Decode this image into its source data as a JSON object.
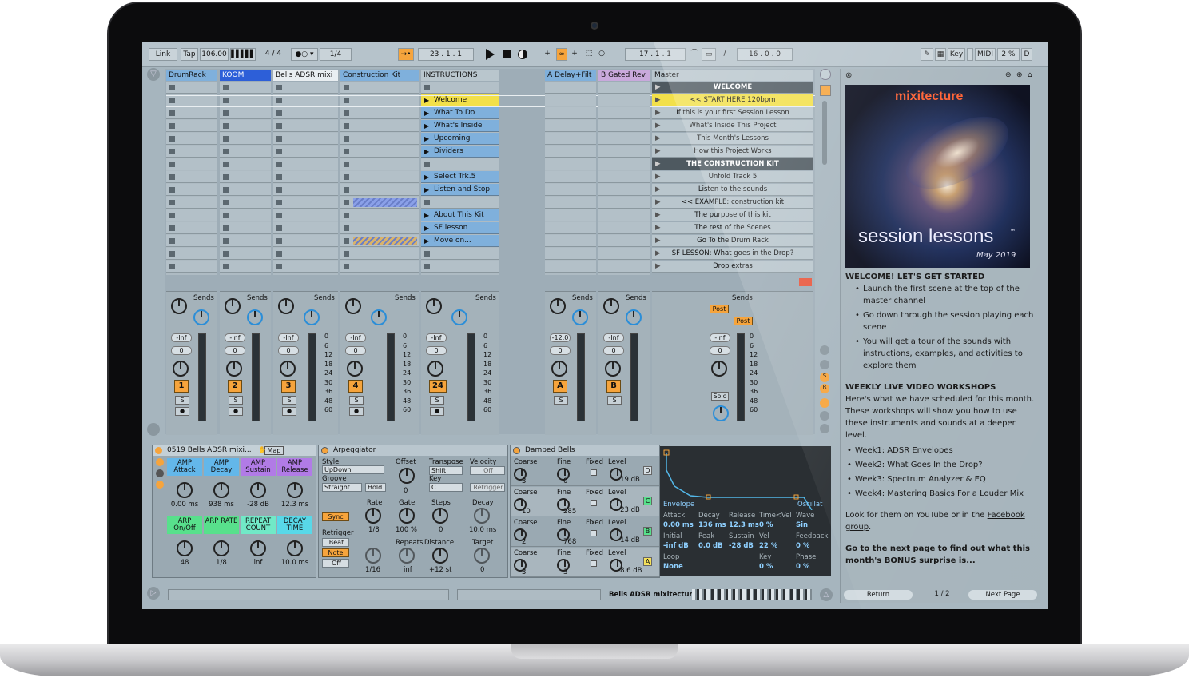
{
  "transport": {
    "link": "Link",
    "tap": "Tap",
    "tempo": "106.00",
    "signature": "4 / 4",
    "quantize": "1/4",
    "position": "23 .   1 .   1",
    "loop_start": "17 .   1 .   1",
    "loop_length": "16 .   0 .   0",
    "key": "Key",
    "midi": "MIDI",
    "cpu": "2 %",
    "d": "D"
  },
  "tracks": [
    {
      "name": "DrumRack",
      "color": "#7fb0dc",
      "number": "1"
    },
    {
      "name": "KOOM",
      "color": "#2d5fd8",
      "number": "2"
    },
    {
      "name": "Bells ADSR mixi",
      "color": "#e9eef1",
      "number": "3"
    },
    {
      "name": "Construction Kit",
      "color": "#7fb0dc",
      "number": "4"
    },
    {
      "name": "INSTRUCTIONS",
      "color": "#b9c6cd",
      "number": "24"
    }
  ],
  "returns": [
    {
      "name": "A Delay+Filt",
      "color": "#7fb0dc",
      "letter": "A"
    },
    {
      "name": "B Gated Rev",
      "color": "#c9a9dc",
      "letter": "B"
    }
  ],
  "master_name": "Master",
  "instruction_clips": [
    {
      "row": 1,
      "label": "Welcome"
    },
    {
      "row": 2,
      "label": "What To Do"
    },
    {
      "row": 3,
      "label": "What's Inside"
    },
    {
      "row": 4,
      "label": "Upcoming"
    },
    {
      "row": 5,
      "label": "Dividers"
    },
    {
      "row": 7,
      "label": "Select Trk.5"
    },
    {
      "row": 8,
      "label": "Listen and Stop"
    },
    {
      "row": 10,
      "label": "About This Kit"
    },
    {
      "row": 11,
      "label": "SF lesson"
    },
    {
      "row": 12,
      "label": "Move on..."
    }
  ],
  "scenes": [
    "WELCOME",
    "<< START HERE 120bpm",
    "If this is your first Session Lesson",
    "What's Inside This Project",
    "This Month's Lessons",
    "How this Project Works",
    "THE CONSTRUCTION KIT",
    "Unfold Track 5",
    "Listen to the sounds",
    "<< EXAMPLE: construction kit",
    "The purpose of this kit",
    "The rest of the Scenes",
    "Go To the Drum Rack",
    "SF LESSON: What goes in the Drop?",
    "Drop extras"
  ],
  "mixer": {
    "sends_label": "Sends",
    "inf": "-Inf",
    "zero": "0",
    "a_vol": "-12.0",
    "solo": "S",
    "master_solo": "Solo",
    "post": "Post",
    "ticks": [
      "0",
      "6",
      "12",
      "18",
      "24",
      "30",
      "36",
      "48",
      "60"
    ]
  },
  "rack": {
    "title": "0519 Bells ADSR mixi...",
    "map": "Map",
    "macros": [
      {
        "label": "AMP Attack",
        "value": "0.00 ms",
        "color": "#63b7ea"
      },
      {
        "label": "AMP Decay",
        "value": "938 ms",
        "color": "#63b7ea"
      },
      {
        "label": "AMP Sustain",
        "value": "-28 dB",
        "color": "#b17be6"
      },
      {
        "label": "AMP Release",
        "value": "12.3 ms",
        "color": "#b17be6"
      },
      {
        "label": "ARP On/Off",
        "value": "48",
        "color": "#58e08c"
      },
      {
        "label": "ARP RATE",
        "value": "1/8",
        "color": "#58e08c"
      },
      {
        "label": "REPEAT COUNT",
        "value": "inf",
        "color": "#71e9c7"
      },
      {
        "label": "DECAY TIME",
        "value": "10.0 ms",
        "color": "#58d8e8"
      }
    ]
  },
  "arpeggiator": {
    "title": "Arpeggiator",
    "style_label": "Style",
    "style": "UpDown",
    "groove_label": "Groove",
    "groove": "Straight",
    "hold": "Hold",
    "offset_label": "Offset",
    "offset": "0",
    "transpose_label": "Transpose",
    "transpose": "Shift",
    "key_label": "Key",
    "key": "C",
    "velocity_label": "Velocity",
    "velocity": "Off",
    "retrigger_btn": "Retrigger",
    "sync": "Sync",
    "rate_label": "Rate",
    "rate": "1/8",
    "gate_label": "Gate",
    "gate": "100 %",
    "steps_label": "Steps",
    "steps": "0",
    "decay_label": "Decay",
    "decay": "10.0 ms",
    "retrigger_label": "Retrigger",
    "beat": "Beat",
    "note": "Note",
    "off": "Off",
    "repeat_value": "1/16",
    "repeats_label": "Repeats",
    "repeats": "inf",
    "distance_label": "Distance",
    "distance": "+12 st",
    "target_label": "Target",
    "target": "0"
  },
  "bells": {
    "title": "Damped Bells",
    "rows": [
      {
        "coarse": "3",
        "fine": "0",
        "level": "-19 dB",
        "op": "D"
      },
      {
        "coarse": "10",
        "fine": "285",
        "level": "-23 dB",
        "op": "C"
      },
      {
        "coarse": "2",
        "fine": "768",
        "level": "-14 dB",
        "op": "B"
      },
      {
        "coarse": "3",
        "fine": "3",
        "level": "-8.6 dB",
        "op": "A"
      }
    ],
    "coarse_label": "Coarse",
    "fine_label": "Fine",
    "fixed_label": "Fixed",
    "level_label": "Level",
    "envelope": "Envelope",
    "oscillator": "Oscillat",
    "env_params": [
      {
        "label": "Attack",
        "value": "0.00 ms"
      },
      {
        "label": "Decay",
        "value": "136 ms"
      },
      {
        "label": "Release",
        "value": "12.3 ms"
      },
      {
        "label": "Time<Vel",
        "value": "0 %"
      },
      {
        "label": "Wave",
        "value": "Sin"
      },
      {
        "label": "Initial",
        "value": "-inf dB"
      },
      {
        "label": "Peak",
        "value": "0.0 dB"
      },
      {
        "label": "Sustain",
        "value": "-28 dB"
      },
      {
        "label": "Vel",
        "value": "22 %"
      },
      {
        "label": "Feedback",
        "value": "0 %"
      },
      {
        "label": "Loop",
        "value": "None"
      },
      {
        "label": "Key",
        "value": "0 %"
      },
      {
        "label": "Phase",
        "value": "0 %"
      }
    ]
  },
  "status": {
    "track_name": "Bells ADSR mixitecture"
  },
  "help": {
    "art_brand": "mixitecture",
    "art_title": "session lessons",
    "art_tm": "™",
    "art_date": "May 2019",
    "h1": "WELCOME! LET'S GET STARTED",
    "bullets1": [
      "Launch the first scene at the top of the master channel",
      "Go down through the session playing each scene",
      "You will get a tour of the sounds with instructions, examples, and activities to explore them"
    ],
    "h2": "WEEKLY LIVE VIDEO WORKSHOPS",
    "p2": "Here's what we have scheduled for this month. These workshops will show you how to use these instruments and sounds at a deeper level.",
    "bullets2": [
      "Week1: ADSR Envelopes",
      "Week2: What Goes In the Drop?",
      "Week3: Spectrum Analyzer & EQ",
      "Week4: Mastering Basics For a Louder Mix"
    ],
    "p3_a": "Look for them on YouTube or in the ",
    "p3_link": "Facebook group",
    "p3_b": ".",
    "p4": "Go to the next page to find out what this month's BONUS surprise is...",
    "return": "Return",
    "page": "1 / 2",
    "next": "Next Page"
  }
}
